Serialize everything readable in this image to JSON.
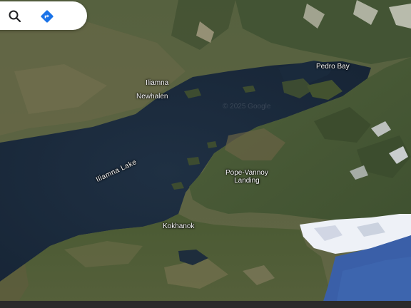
{
  "toolbar": {
    "search_icon": "search-icon",
    "directions_icon": "directions-icon",
    "directions_color": "#1a73e8"
  },
  "places": {
    "iliamna": "Iliamna",
    "newhalen": "Newhalen",
    "pedro_bay": "Pedro Bay",
    "lake": "Iliamna Lake",
    "pope_vannoy_line1": "Pope-Vannoy",
    "pope_vannoy_line2": "Landing",
    "kokhanok": "Kokhanok"
  },
  "watermark": "© 2025 Google",
  "colors": {
    "lake": "#1a2a3c",
    "land": "#4c5a38",
    "ocean": "#3a5fa8",
    "snow": "#ecf0f6"
  }
}
